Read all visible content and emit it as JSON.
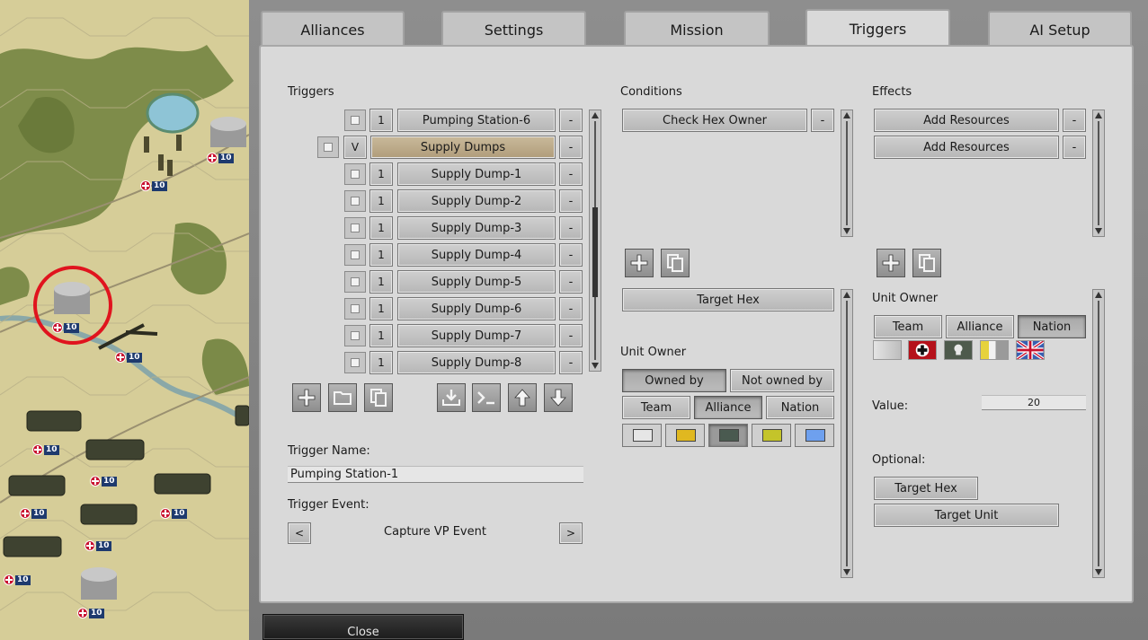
{
  "map": {
    "unit_strength": "10"
  },
  "tabs": [
    {
      "label": "Alliances"
    },
    {
      "label": "Settings"
    },
    {
      "label": "Mission"
    },
    {
      "label": "Triggers"
    },
    {
      "label": "AI Setup"
    }
  ],
  "active_tab": "Triggers",
  "triggers": {
    "heading": "Triggers",
    "items": [
      {
        "count": "1",
        "label": "Pumping Station-6"
      },
      {
        "count": "V",
        "label": "Supply Dumps",
        "group": true
      },
      {
        "count": "1",
        "label": "Supply Dump-1"
      },
      {
        "count": "1",
        "label": "Supply Dump-2"
      },
      {
        "count": "1",
        "label": "Supply Dump-3"
      },
      {
        "count": "1",
        "label": "Supply Dump-4"
      },
      {
        "count": "1",
        "label": "Supply Dump-5"
      },
      {
        "count": "1",
        "label": "Supply Dump-6"
      },
      {
        "count": "1",
        "label": "Supply Dump-7"
      },
      {
        "count": "1",
        "label": "Supply Dump-8"
      }
    ],
    "remove_label": "-",
    "name_label": "Trigger Name:",
    "name_value": "Pumping Station-1",
    "event_label": "Trigger Event:",
    "event_value": "Capture VP Event",
    "prev": "<",
    "next": ">"
  },
  "conditions": {
    "heading": "Conditions",
    "items": [
      {
        "label": "Check Hex Owner"
      }
    ],
    "remove_label": "-",
    "target_hex": "Target Hex",
    "unit_owner_label": "Unit Owner",
    "owned_by": "Owned by",
    "not_owned_by": "Not owned by",
    "team": "Team",
    "alliance": "Alliance",
    "nation": "Nation",
    "colors": [
      "#e6e6e6",
      "#e0b820",
      "#4a5a50",
      "#c4c42a",
      "#6ea0ee"
    ]
  },
  "effects": {
    "heading": "Effects",
    "items": [
      {
        "label": "Add Resources"
      },
      {
        "label": "Add Resources"
      }
    ],
    "remove_label": "-",
    "unit_owner_label": "Unit Owner",
    "team": "Team",
    "alliance": "Alliance",
    "nation": "Nation",
    "value_label": "Value:",
    "value": "20",
    "optional_label": "Optional:",
    "target_hex": "Target Hex",
    "target_unit": "Target Unit"
  },
  "close_label": "Close"
}
